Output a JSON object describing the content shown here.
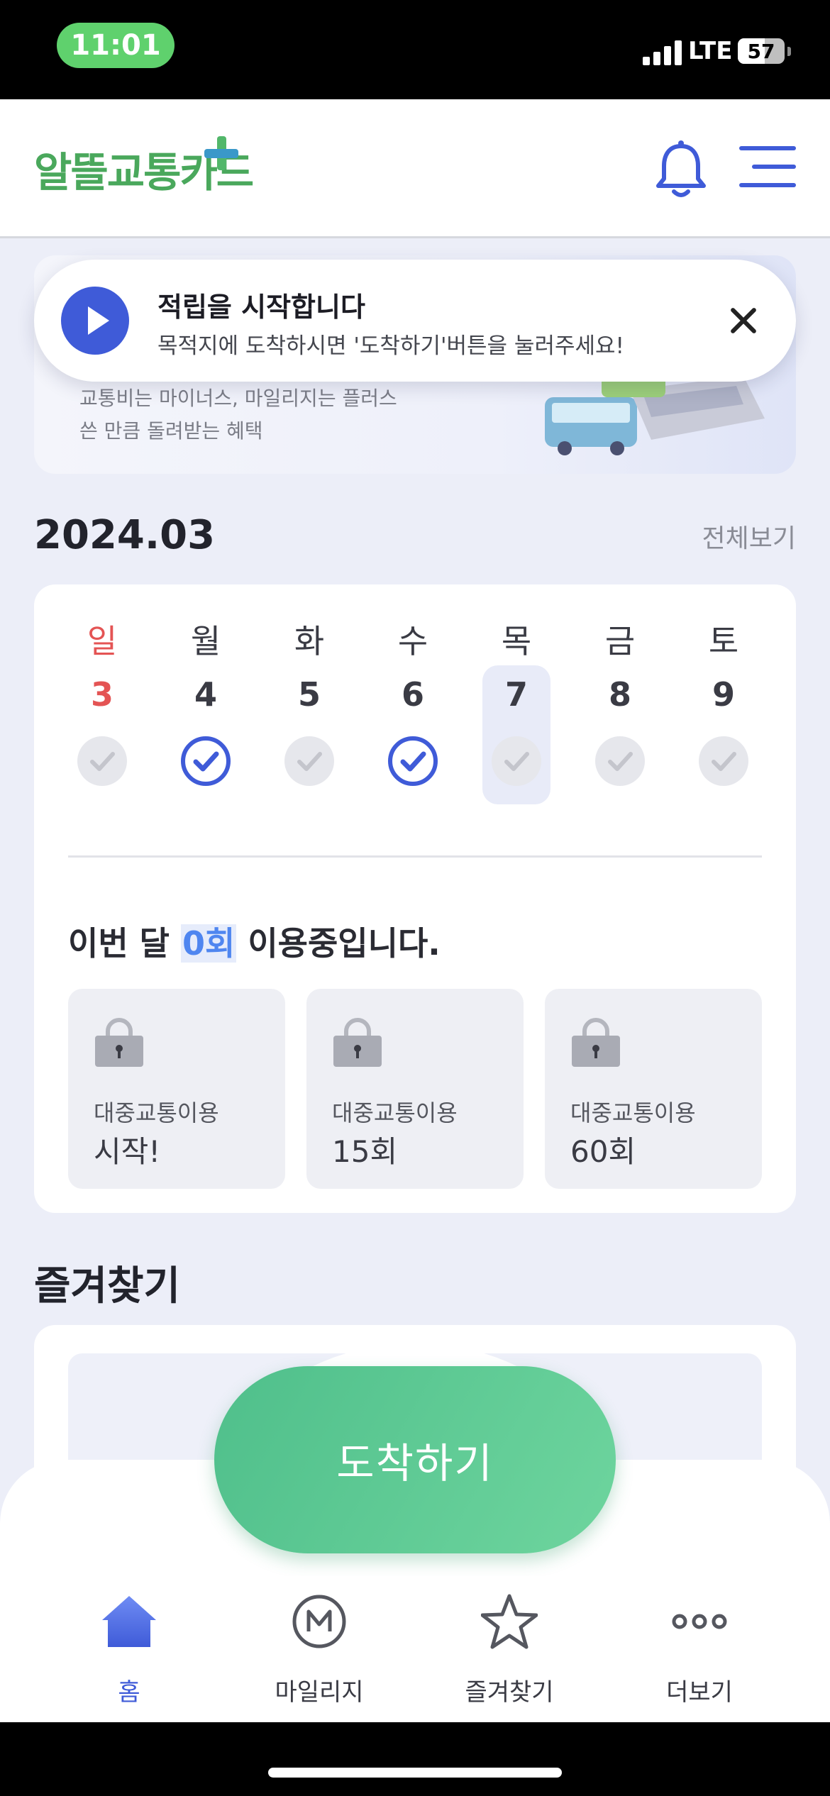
{
  "status_bar": {
    "time": "11:01",
    "network": "LTE",
    "battery": "57",
    "battery_level": 0.57
  },
  "header": {
    "logo_text": "알뜰교통카드"
  },
  "banner": {
    "line1": "교통비는 마이너스, 마일리지는 플러스",
    "line2": "쓴 만큼 돌려받는 혜택"
  },
  "toast": {
    "title": "적립을 시작합니다",
    "message": "목적지에 도착하시면 '도착하기'버튼을 눌러주세요!"
  },
  "calendar": {
    "month": "2024.03",
    "view_all": "전체보기",
    "days": [
      {
        "name": "일",
        "num": "3",
        "checked": false,
        "sunday": true
      },
      {
        "name": "월",
        "num": "4",
        "checked": true
      },
      {
        "name": "화",
        "num": "5",
        "checked": false
      },
      {
        "name": "수",
        "num": "6",
        "checked": true
      },
      {
        "name": "목",
        "num": "7",
        "checked": false,
        "today": true
      },
      {
        "name": "금",
        "num": "8",
        "checked": false
      },
      {
        "name": "토",
        "num": "9",
        "checked": false
      }
    ],
    "usage_prefix": "이번 달 ",
    "usage_count": "0회",
    "usage_suffix": " 이용중입니다.",
    "rewards": [
      {
        "label": "대중교통이용",
        "value": "시작!"
      },
      {
        "label": "대중교통이용",
        "value": "15회"
      },
      {
        "label": "대중교통이용",
        "value": "60회"
      }
    ]
  },
  "favorites": {
    "title": "즐겨찾기"
  },
  "arrive_button": "도착하기",
  "tabs": [
    {
      "label": "홈",
      "icon": "home-icon",
      "active": true
    },
    {
      "label": "마일리지",
      "icon": "mileage-icon"
    },
    {
      "label": "즐겨찾기",
      "icon": "star-icon"
    },
    {
      "label": "더보기",
      "icon": "more-icon"
    }
  ],
  "colors": {
    "accent": "#3f5bd8",
    "arrive_green": "#5cc996",
    "sunday_red": "#e45454",
    "status_green": "#5fd16d"
  }
}
